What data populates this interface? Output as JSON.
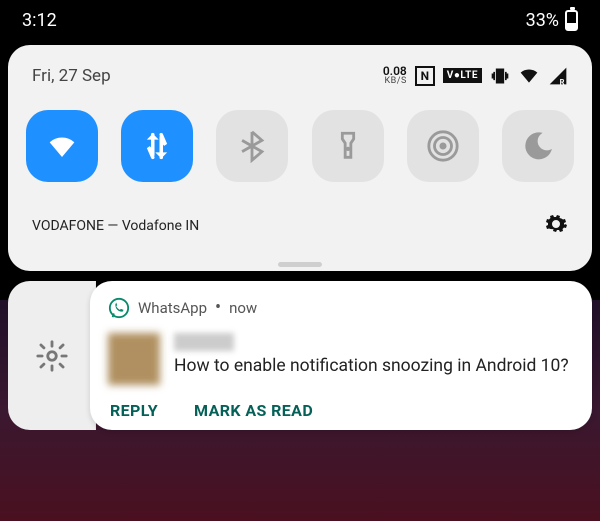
{
  "statusbar": {
    "time": "3:12",
    "battery_pct": "33%"
  },
  "qs": {
    "date": "Fri, 27 Sep",
    "data_rate_num": "0.08",
    "data_rate_unit": "KB/S",
    "nfc_label": "N",
    "volte_label": "V●LTE",
    "carrier": "VODAFONE — Vodafone IN"
  },
  "tiles": {
    "wifi": "wifi",
    "data": "mobile-data",
    "bt": "bluetooth",
    "torch": "flashlight",
    "hotspot": "hotspot",
    "dnd": "dnd"
  },
  "notif": {
    "app": "WhatsApp",
    "time": "now",
    "body": "How to enable notification snoozing in Android 10?",
    "action_reply": "REPLY",
    "action_read": "MARK AS READ"
  }
}
